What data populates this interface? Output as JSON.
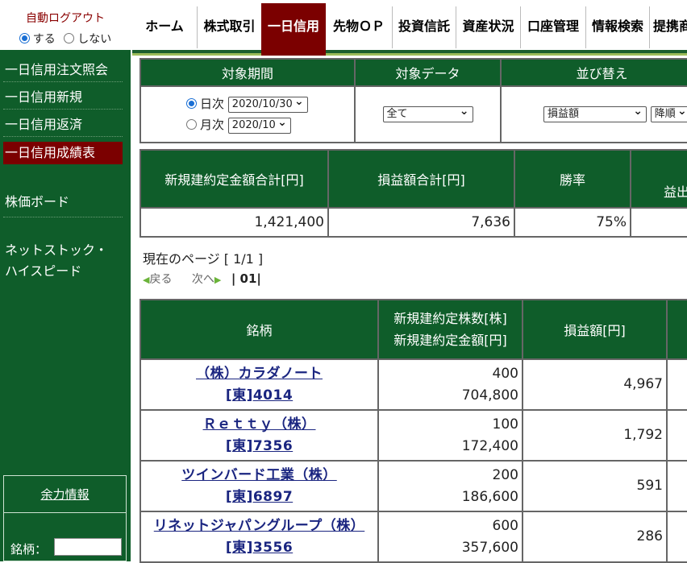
{
  "auto_logout": {
    "title": "自動ログアウト",
    "options": [
      "する",
      "しない"
    ]
  },
  "nav": {
    "tabs": [
      "ホーム",
      "株式取引",
      "一日信用",
      "先物ＯＰ",
      "投資信託",
      "資産状況",
      "口座管理",
      "情報検索",
      "提携商"
    ]
  },
  "sidebar": {
    "items": [
      "一日信用注文照会",
      "一日信用新規",
      "一日信用返済",
      "一日信用成績表",
      "株価ボード",
      "ネットストック・",
      "ハイスピード"
    ],
    "yoryoku_label": "余力情報",
    "meigara_label": "銘柄："
  },
  "filter": {
    "headers": [
      "対象期間",
      "対象データ",
      "並び替え"
    ],
    "daily_label": "日次",
    "daily_value": "2020/10/30",
    "monthly_label": "月次",
    "monthly_value": "2020/10",
    "data_value": "全て",
    "sort_key": "損益額",
    "sort_order": "降順"
  },
  "summary": {
    "headers": [
      "新規建約定金額合計[円]",
      "損益額合計[円]",
      "勝率"
    ],
    "sub_header": "益出",
    "values": [
      "1,421,400",
      "7,636",
      "75%"
    ]
  },
  "paging": {
    "current_label": "現在のページ [ 1/1 ]",
    "prev": "戻る",
    "next": "次へ",
    "page": "01"
  },
  "results": {
    "headers": {
      "name": "銘柄",
      "shares": "新規建約定株数[株]",
      "amount": "新規建約定金額[円]",
      "pnl": "損益額[円]"
    },
    "rows": [
      {
        "name": "（株）カラダノート",
        "code": "[東]4014",
        "shares": "400",
        "amount": "704,800",
        "pnl": "4,967"
      },
      {
        "name": "Ｒｅｔｔｙ（株）",
        "code": "[東]7356",
        "shares": "100",
        "amount": "172,400",
        "pnl": "1,792"
      },
      {
        "name": "ツインバード工業（株）",
        "code": "[東]6897",
        "shares": "200",
        "amount": "186,600",
        "pnl": "591"
      },
      {
        "name": "リネットジャパングループ（株）",
        "code": "[東]3556",
        "shares": "600",
        "amount": "357,600",
        "pnl": "286"
      }
    ]
  }
}
